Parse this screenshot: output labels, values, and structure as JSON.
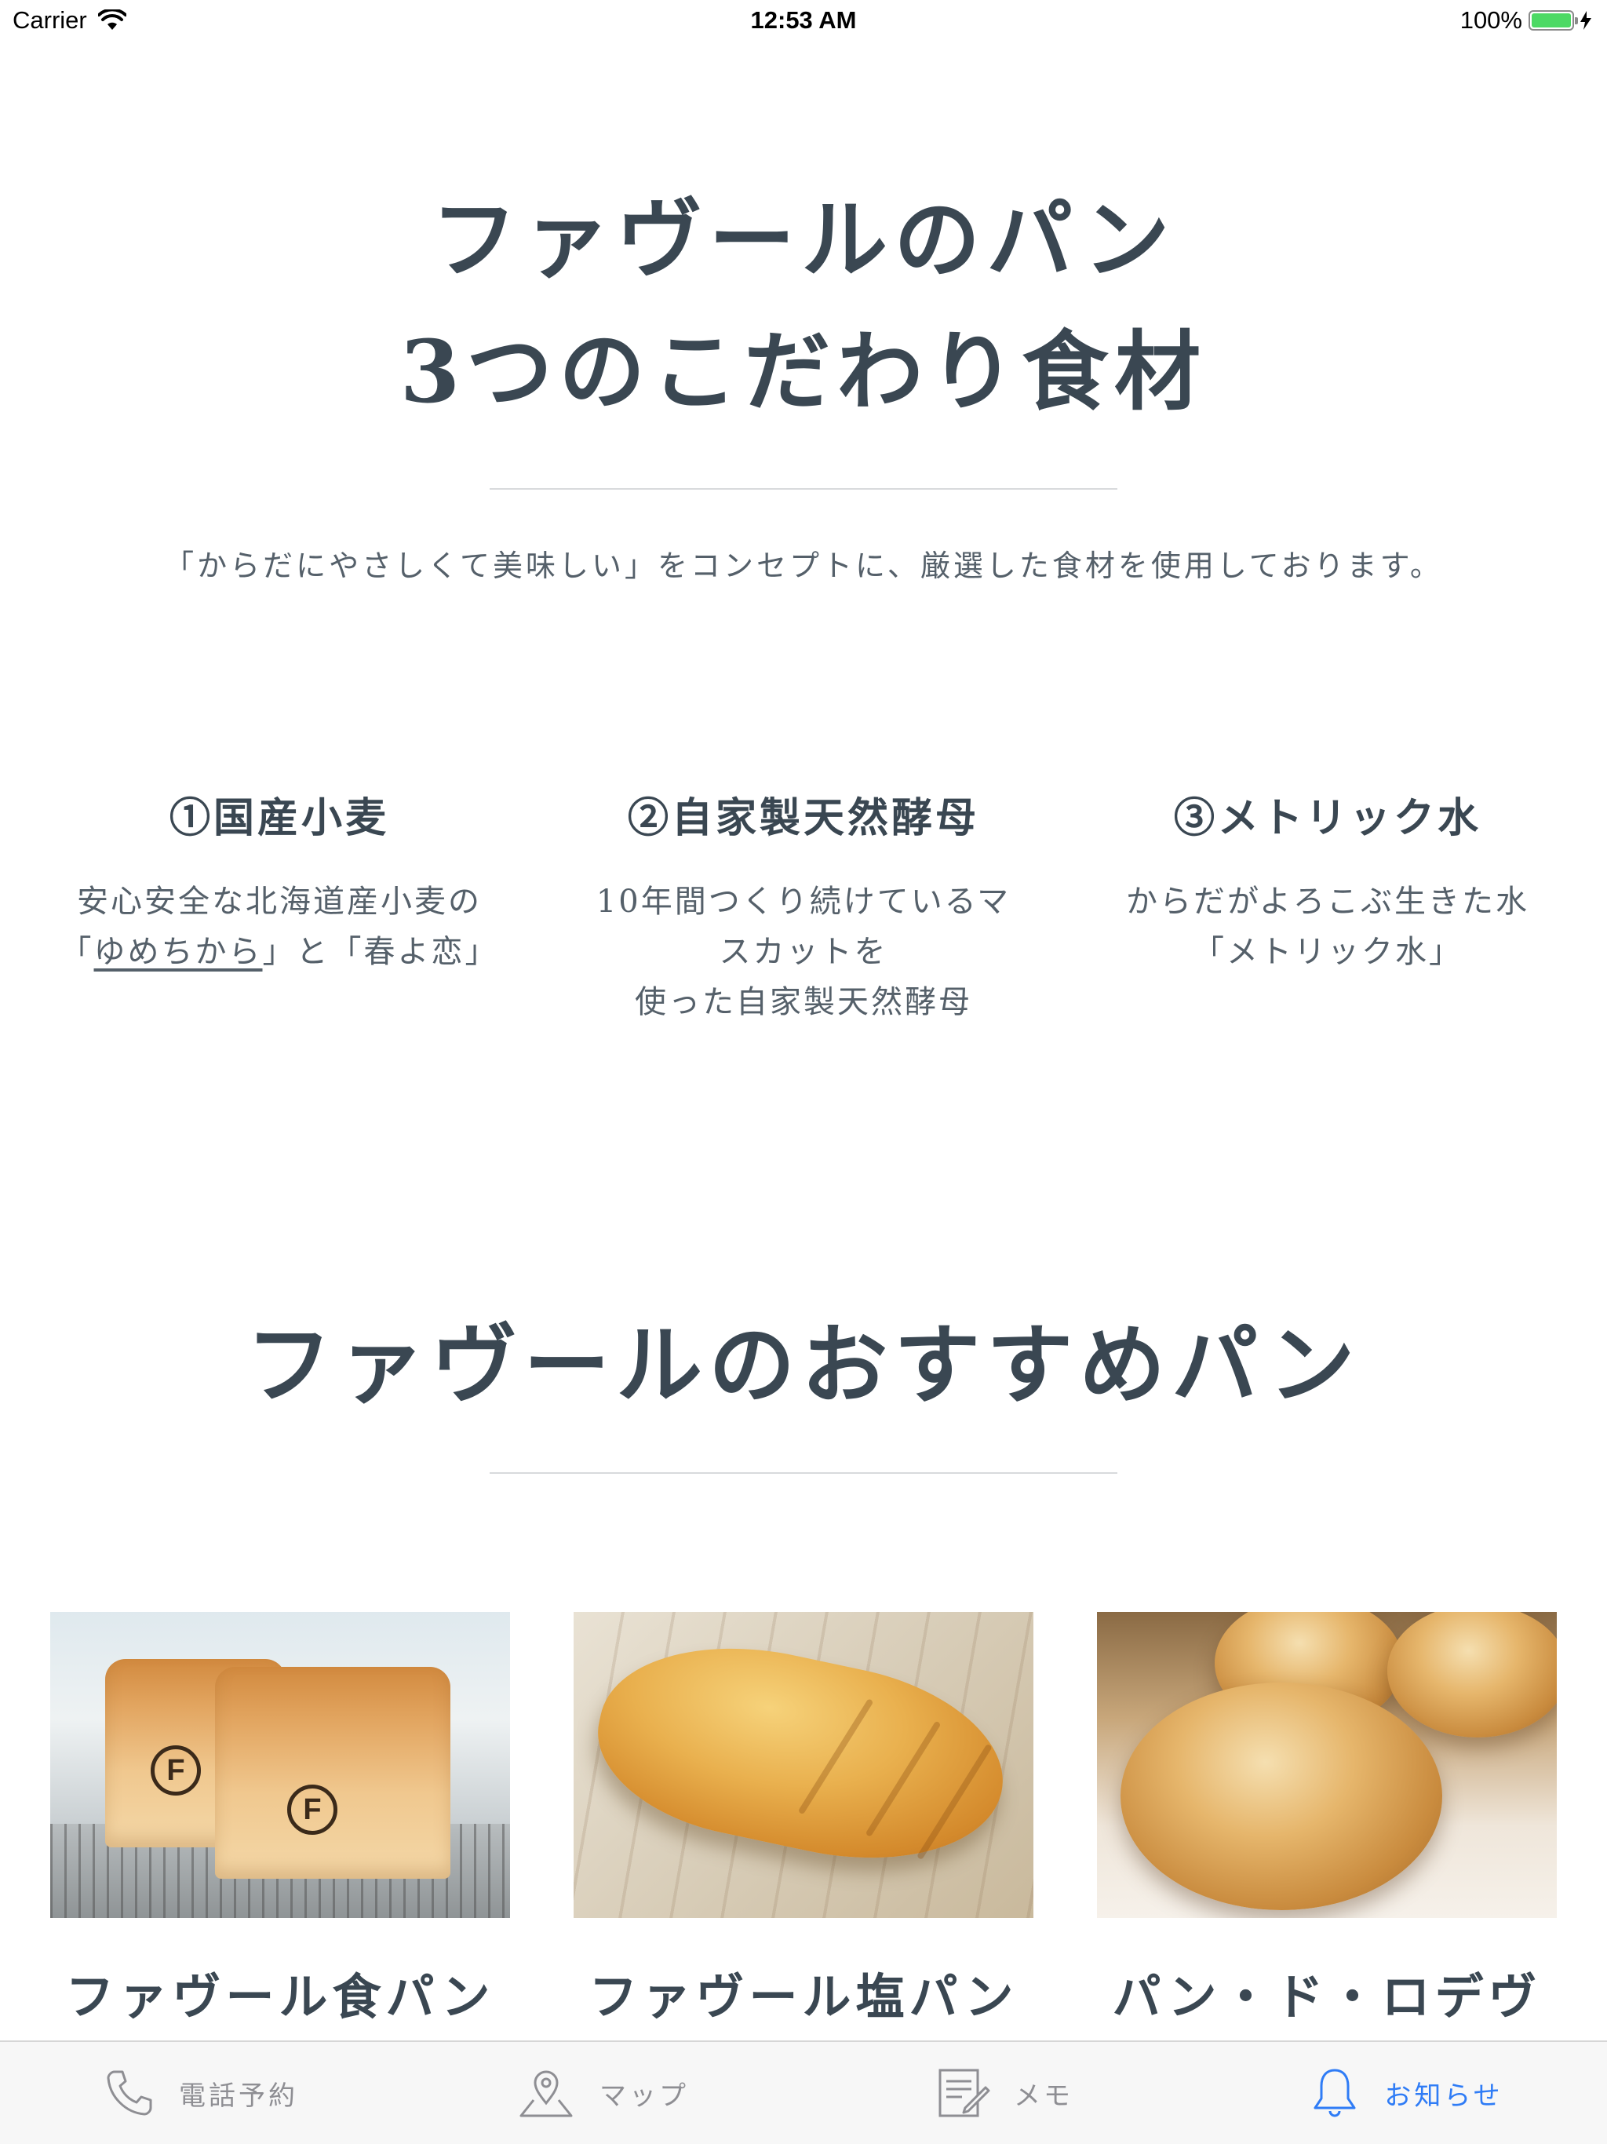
{
  "status_bar": {
    "carrier": "Carrier",
    "time": "12:53 AM",
    "battery": "100%",
    "battery_level": 1.0
  },
  "hero": {
    "title_line1": "ファヴールのパン",
    "title_line2": "3つのこだわり食材",
    "intro": "「からだにやさしくて美味しい」をコンセプトに、厳選した食材を使用しております。"
  },
  "features": [
    {
      "title": "①国産小麦",
      "desc_line1": "安心安全な北海道産小麦の",
      "desc_line2_pre": "「",
      "desc_line2_link": "ゆめちから",
      "desc_line2_post": "」と「春よ恋」"
    },
    {
      "title": "②自家製天然酵母",
      "desc_line1": "10年間つくり続けているマ",
      "desc_line2": "スカットを",
      "desc_line3": "使った自家製天然酵母"
    },
    {
      "title": "③メトリック水",
      "desc_line1": "からだがよろこぶ生きた水",
      "desc_line2": "「メトリック水」"
    }
  ],
  "recommend": {
    "title": "ファヴールのおすすめパン",
    "products": [
      {
        "name": "ファヴール食パン",
        "image": "shokupan-photo"
      },
      {
        "name": "ファヴール塩パン",
        "image": "shio-pan-photo"
      },
      {
        "name": "パン・ド・ロデヴ",
        "image": "pain-de-lodeve-photo"
      }
    ]
  },
  "tab_bar": {
    "active": "news",
    "items": [
      {
        "id": "phone",
        "label": "電話予約",
        "icon": "phone-icon"
      },
      {
        "id": "map",
        "label": "マップ",
        "icon": "map-pin-icon"
      },
      {
        "id": "memo",
        "label": "メモ",
        "icon": "memo-icon"
      },
      {
        "id": "news",
        "label": "お知らせ",
        "icon": "bell-icon"
      }
    ]
  },
  "colors": {
    "heading": "#3a4752",
    "body_text": "#55606a",
    "tab_inactive": "#8e8e93",
    "tab_active": "#2f7cf6",
    "battery": "#4cd964"
  }
}
